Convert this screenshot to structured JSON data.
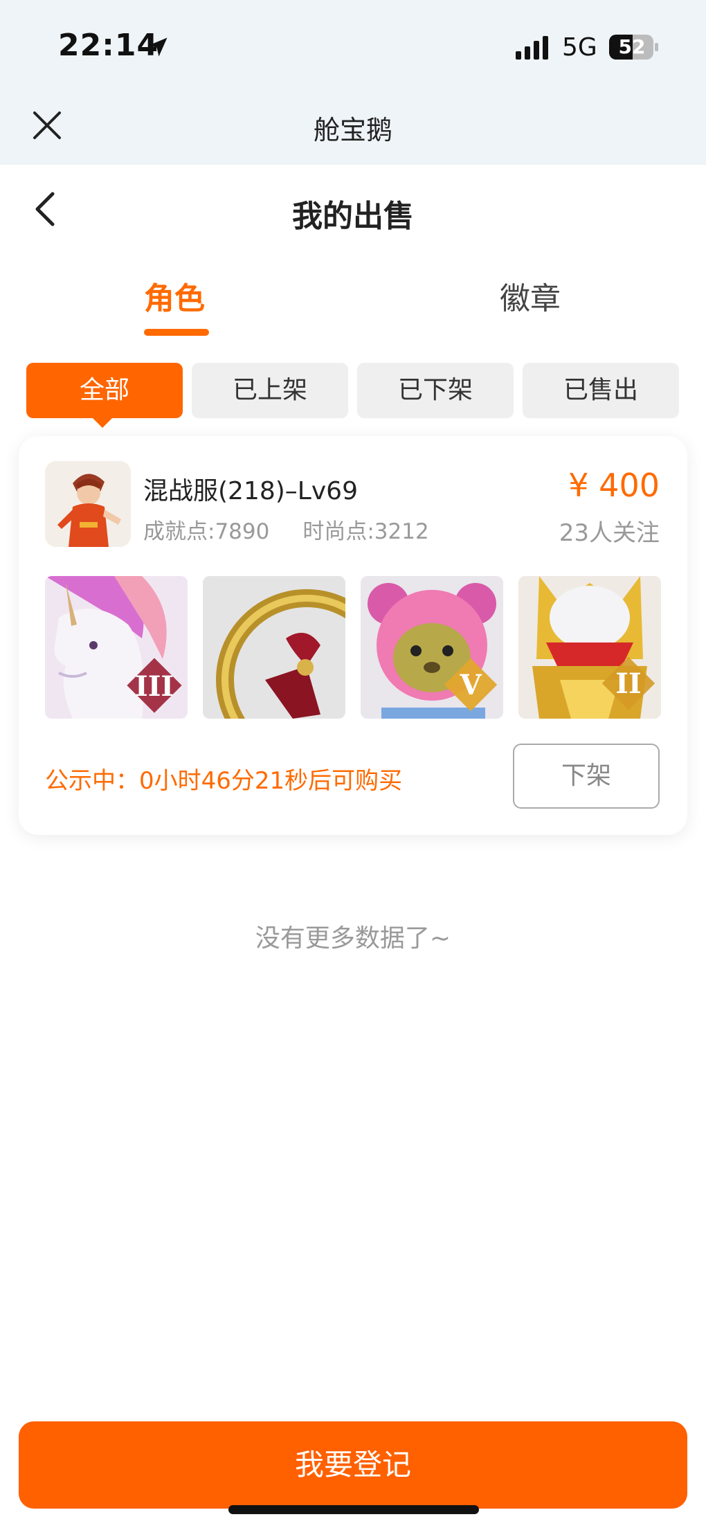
{
  "status_bar": {
    "time": "22:14",
    "network": "5G",
    "battery": "52"
  },
  "title_bar": {
    "app_name": "舱宝鹅"
  },
  "nav": {
    "page_title": "我的出售"
  },
  "tabs": [
    {
      "label": "角色",
      "active": true
    },
    {
      "label": "徽章",
      "active": false
    }
  ],
  "filters": [
    {
      "label": "全部",
      "active": true
    },
    {
      "label": "已上架",
      "active": false
    },
    {
      "label": "已下架",
      "active": false
    },
    {
      "label": "已售出",
      "active": false
    }
  ],
  "listing": {
    "server_level": "混战服(218)–Lv69",
    "achievement": "成就点:7890",
    "fashion": "时尚点:3212",
    "price": "¥ 400",
    "followers": "23人关注",
    "items": [
      {
        "name": "unicorn-mount",
        "rank": "III"
      },
      {
        "name": "golden-ring-emblem",
        "rank": ""
      },
      {
        "name": "pink-bear-pet",
        "rank": "V"
      },
      {
        "name": "golden-armor-helmet",
        "rank": "II"
      }
    ],
    "publicity_text": "公示中：0小时46分21秒后可购买",
    "delist_label": "下架"
  },
  "footer": {
    "no_more_text": "没有更多数据了~",
    "register_label": "我要登记"
  },
  "colors": {
    "accent": "#ff6500",
    "chip_bg": "#efefef",
    "header_bg": "#eef4f7"
  }
}
